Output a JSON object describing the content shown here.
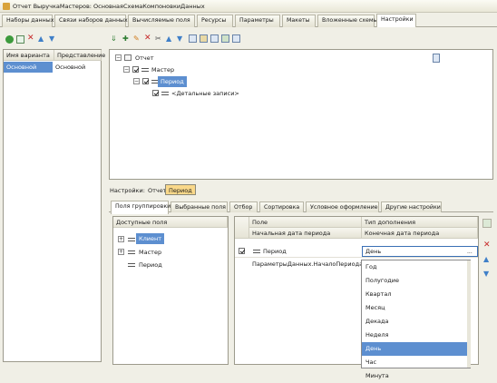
{
  "window": {
    "title": "Отчет ВыручкаМастеров: ОсновнаяСхемаКомпоновкиДанных"
  },
  "main_tabs": [
    {
      "label": "Наборы данных"
    },
    {
      "label": "Связи наборов данных"
    },
    {
      "label": "Вычисляемые поля"
    },
    {
      "label": "Ресурсы"
    },
    {
      "label": "Параметры"
    },
    {
      "label": "Макеты"
    },
    {
      "label": "Вложенные схемы"
    },
    {
      "label": "Настройки"
    }
  ],
  "variants": {
    "headers": {
      "name": "Имя варианта",
      "repr": "Представление"
    },
    "rows": [
      {
        "name": "Основной",
        "repr": "Основной"
      }
    ]
  },
  "structure_tree": {
    "root": "Отчет",
    "level1": "Мастер",
    "level2": "Период",
    "level3": "<Детальные записи>"
  },
  "settings_bar": {
    "label": "Настройки:",
    "report_btn": "Отчет",
    "period_btn": "Период"
  },
  "settings_tabs": [
    {
      "label": "Поля группировки"
    },
    {
      "label": "Выбранные поля"
    },
    {
      "label": "Отбор"
    },
    {
      "label": "Сортировка"
    },
    {
      "label": "Условное оформление"
    },
    {
      "label": "Другие настройки"
    }
  ],
  "available_fields": {
    "header": "Доступные поля",
    "items": [
      {
        "label": "Клиент"
      },
      {
        "label": "Мастер"
      },
      {
        "label": "Период"
      }
    ]
  },
  "grouping_table": {
    "col_field": "Поле",
    "col_type": "Тип дополнения",
    "sub_col_start": "Начальная дата периода",
    "sub_col_end": "Конечная дата периода",
    "row_field": "Период",
    "row_type": "День",
    "row2_start": "ПараметрыДанных.НачалоПериода"
  },
  "dropdown": {
    "options": [
      "Год",
      "Полугодие",
      "Квартал",
      "Месяц",
      "Декада",
      "Неделя",
      "День",
      "Час",
      "Минута"
    ],
    "selected": "День"
  },
  "colors": {
    "selection": "#5d8fd0",
    "window_bg": "#f0efe6"
  }
}
